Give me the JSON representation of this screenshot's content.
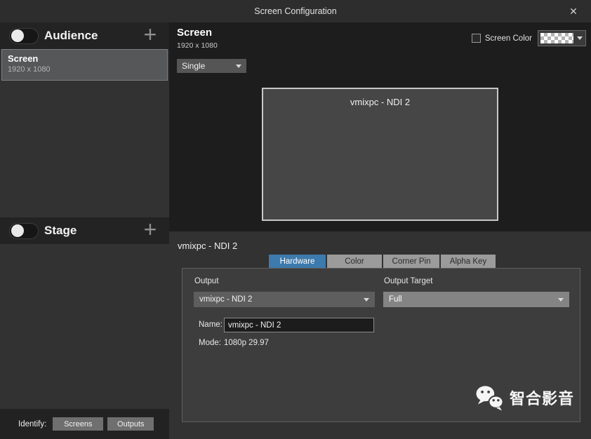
{
  "window": {
    "title": "Screen Configuration"
  },
  "icons": {
    "close": "✕",
    "add": "+"
  },
  "sidebar": {
    "audience": {
      "label": "Audience",
      "toggle_on": false
    },
    "stage": {
      "label": "Stage",
      "toggle_on": false
    },
    "screen_item": {
      "title": "Screen",
      "subtitle": "1920 x 1080",
      "selected": true
    },
    "identify": {
      "label": "Identify:",
      "screens_button": "Screens",
      "outputs_button": "Outputs"
    }
  },
  "main": {
    "header": {
      "title": "Screen",
      "subtitle": "1920 x 1080"
    },
    "screen_color": {
      "label": "Screen Color",
      "checked": false,
      "swatch": "transparent-checkerboard"
    },
    "layout_select": {
      "value": "Single"
    },
    "preview": {
      "label": "vmixpc - NDI 2"
    }
  },
  "output_section": {
    "title": "vmixpc - NDI 2",
    "tabs": [
      {
        "label": "Hardware",
        "active": true
      },
      {
        "label": "Color",
        "active": false
      },
      {
        "label": "Corner Pin",
        "active": false
      },
      {
        "label": "Alpha Key",
        "active": false
      }
    ],
    "output": {
      "label": "Output",
      "value": "vmixpc - NDI 2"
    },
    "output_target": {
      "label": "Output Target",
      "value": "Full"
    },
    "name": {
      "label": "Name:",
      "value": "vmixpc - NDI 2"
    },
    "mode": {
      "label": "Mode:",
      "value": "1080p 29.97"
    }
  },
  "watermark": {
    "text": "智合影音"
  },
  "colors": {
    "tab_active": "#3d7aad",
    "panel_bg": "#3d3d3d",
    "sidebar_bg": "#323232",
    "titlebar_bg": "#2d2d2d",
    "selected_item_bg": "#565758"
  }
}
